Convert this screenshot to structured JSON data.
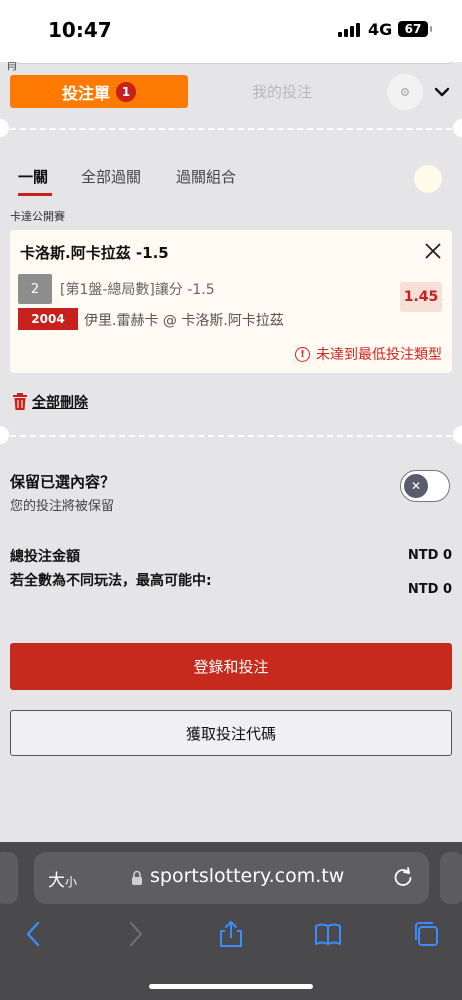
{
  "status_bar": {
    "time": "10:47",
    "network": "4G",
    "battery": "67"
  },
  "sheet": {
    "top_glyph": "肖"
  },
  "header": {
    "tab_betslip": "投注單",
    "betslip_count": "1",
    "tab_my_bets": "我的投注"
  },
  "subtabs": {
    "single": "一關",
    "all_parlay": "全部過關",
    "parlay_combo": "過關組合"
  },
  "league": "卡達公開賽",
  "selection": {
    "title": "卡洛斯.阿卡拉茲 -1.5",
    "number": "2",
    "market": "[第1盤-總局數]讓分 -1.5",
    "odds": "1.45",
    "match_code": "2004",
    "teams": "伊里.雷赫卡 @ 卡洛斯.阿卡拉茲",
    "warning": "未達到最低投注類型"
  },
  "delete_all": "全部刪除",
  "keep_selections": {
    "title": "保留已選內容？",
    "subtitle": "您的投注將被保留"
  },
  "totals": {
    "total_label": "總投注金額",
    "total_value": "NTD 0",
    "max_win_label": "若全數為不同玩法，最高可能中:",
    "max_win_value": "NTD 0"
  },
  "buttons": {
    "login_bet": "登錄和投注",
    "get_code": "獲取投注代碼"
  },
  "browser": {
    "text_size_big": "大",
    "text_size_small": "小",
    "url": "sportslottery.com.tw"
  },
  "colors": {
    "accent_orange": "#ff7a00",
    "brand_red": "#c62a1c",
    "sheet_bg": "#e5e5e8"
  }
}
